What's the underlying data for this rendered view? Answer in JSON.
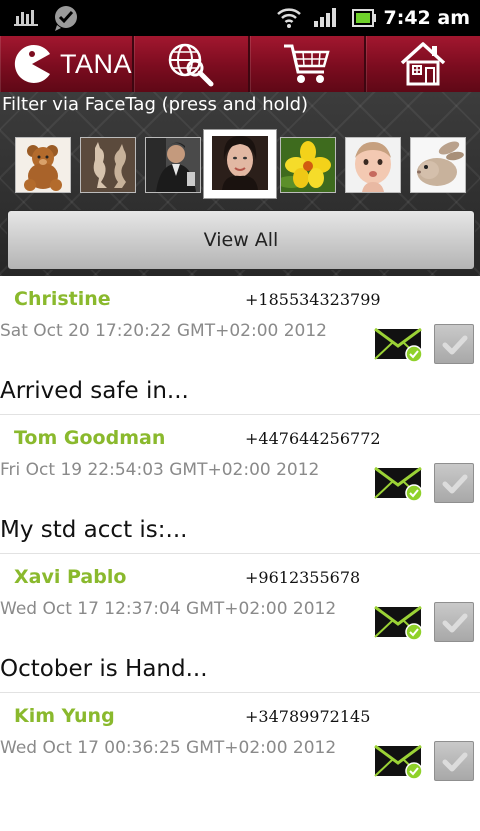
{
  "status_bar": {
    "time": "7:42 am",
    "icons": [
      "signal-stats-icon",
      "messenger-icon",
      "wifi-icon",
      "cell-signal-icon",
      "battery-icon"
    ]
  },
  "nav": {
    "logo_text": "TANA",
    "items": [
      "globe-search-icon",
      "cart-icon",
      "home-icon"
    ]
  },
  "filter": {
    "label": "Filter via FaceTag (press and hold)",
    "faces": [
      "teddy-bear",
      "kangaroos",
      "man-in-suit",
      "woman-portrait",
      "yellow-flower",
      "baby",
      "bunny"
    ],
    "selected_index": 3,
    "view_all_label": "View All"
  },
  "colors": {
    "nav_red": "#7b0c1f",
    "name_green": "#8ab92d",
    "envelope_green": "#9bd236"
  },
  "messages": [
    {
      "name": "Christine",
      "phone": "+185534323799",
      "date": "Sat Oct 20 17:20:22 GMT+02:00 2012",
      "preview": "Arrived safe in...",
      "read": true
    },
    {
      "name": "Tom Goodman",
      "phone": "+447644256772",
      "date": "Fri Oct 19 22:54:03 GMT+02:00 2012",
      "preview": "My std acct is:...",
      "read": true
    },
    {
      "name": "Xavi Pablo",
      "phone": "+9612355678",
      "date": "Wed Oct 17 12:37:04 GMT+02:00 2012",
      "preview": "October is Hand...",
      "read": true
    },
    {
      "name": "Kim Yung",
      "phone": "+34789972145",
      "date": "Wed Oct 17 00:36:25 GMT+02:00 2012",
      "preview": "",
      "read": true
    }
  ]
}
